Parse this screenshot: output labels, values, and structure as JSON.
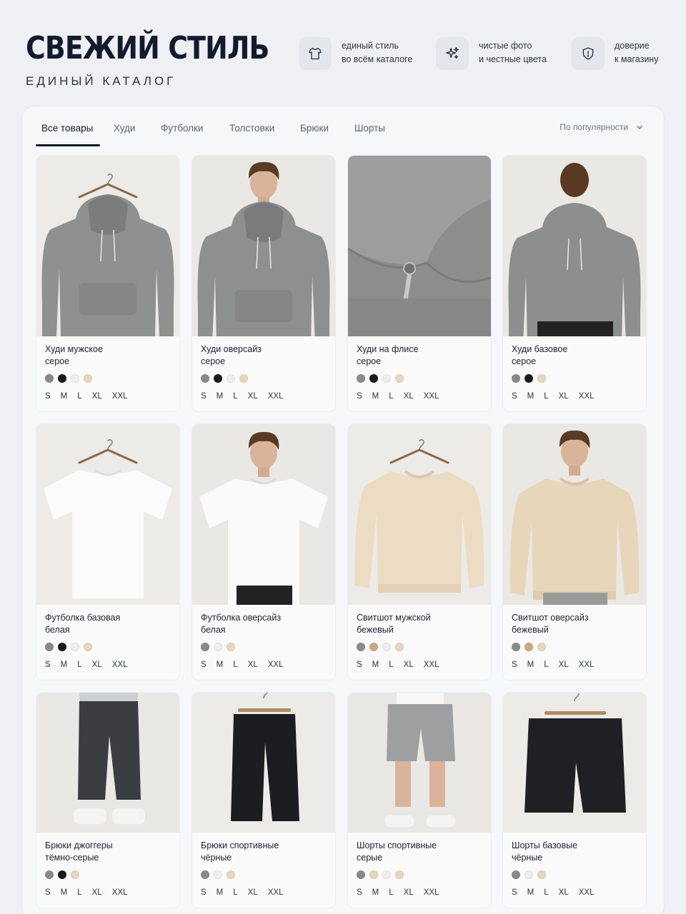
{
  "brand": {
    "title": "СВЕЖИЙ СТИЛЬ",
    "subtitle": "ЕДИНЫЙ КАТАЛОГ"
  },
  "features": [
    {
      "icon": "tshirt-icon",
      "line1": "единый стиль",
      "line2": "во всём каталоге"
    },
    {
      "icon": "sparkles-icon",
      "line1": "чистые фото",
      "line2": "и честные цвета"
    },
    {
      "icon": "shield-icon",
      "line1": "доверие",
      "line2": "к магазину"
    }
  ],
  "tabs": [
    "Все товары",
    "Худи",
    "Футболки",
    "Толстовки",
    "Брюки",
    "Шорты"
  ],
  "active_tab": "Все товары",
  "sort": {
    "label": "По популярности",
    "icon": "chevron-down-icon"
  },
  "sizes": [
    "S",
    "M",
    "L",
    "XL",
    "XXL"
  ],
  "colors": {
    "grey": "#8a8a8a",
    "black": "#1a1a1a",
    "white": "#eeeeee",
    "beige": "#e6d6bd",
    "tan": "#c9a980",
    "accent": "#141a2b"
  },
  "products": [
    {
      "name_l1": "Худи мужское",
      "name_l2": "серое",
      "swatches": [
        "#8a8a8a",
        "#1a1a1a",
        "#eeeeee",
        "#e6d6bd"
      ],
      "image": "hoodie-hanger"
    },
    {
      "name_l1": "Худи оверсайз",
      "name_l2": "серое",
      "swatches": [
        "#8a8a8a",
        "#1a1a1a",
        "#eeeeee",
        "#e6d6bd"
      ],
      "image": "hoodie-model"
    },
    {
      "name_l1": "Худи на флисе",
      "name_l2": "серое",
      "swatches": [
        "#8a8a8a",
        "#1a1a1a",
        "#eeeeee",
        "#e6d6bd"
      ],
      "image": "hoodie-detail"
    },
    {
      "name_l1": "Худи базовое",
      "name_l2": "серое",
      "swatches": [
        "#8a8a8a",
        "#1a1a1a",
        "#e6d6bd"
      ],
      "image": "hoodie-back"
    },
    {
      "name_l1": "Футболка базовая",
      "name_l2": "белая",
      "swatches": [
        "#8a8a8a",
        "#1a1a1a",
        "#eeeeee",
        "#e6d6bd"
      ],
      "image": "tee-hanger"
    },
    {
      "name_l1": "Футболка оверсайз",
      "name_l2": "белая",
      "swatches": [
        "#8a8a8a",
        "#eeeeee",
        "#e6d6bd"
      ],
      "image": "tee-model"
    },
    {
      "name_l1": "Свитшот мужской",
      "name_l2": "бежевый",
      "swatches": [
        "#8a8a8a",
        "#c9a980",
        "#eeeeee",
        "#e6d6bd"
      ],
      "image": "sweat-hanger"
    },
    {
      "name_l1": "Свитшот оверсайз",
      "name_l2": "бежевый",
      "swatches": [
        "#8a8a8a",
        "#c9a980",
        "#e6d6bd"
      ],
      "image": "sweat-model"
    },
    {
      "name_l1": "Брюки джоггеры",
      "name_l2": "тёмно-серые",
      "swatches": [
        "#8a8a8a",
        "#1a1a1a",
        "#e6d6bd"
      ],
      "image": "joggers-model"
    },
    {
      "name_l1": "Брюки спортивные",
      "name_l2": "чёрные",
      "swatches": [
        "#8a8a8a",
        "#eeeeee",
        "#e6d6bd"
      ],
      "image": "pants-hanger"
    },
    {
      "name_l1": "Шорты спортивные",
      "name_l2": "серые",
      "swatches": [
        "#8a8a8a",
        "#e6d6bd",
        "#eeeeee",
        "#e6d6bd"
      ],
      "image": "shorts-model"
    },
    {
      "name_l1": "Шорты базовые",
      "name_l2": "чёрные",
      "swatches": [
        "#8a8a8a",
        "#eeeeee",
        "#e6d6bd"
      ],
      "image": "shorts-hanger"
    }
  ]
}
